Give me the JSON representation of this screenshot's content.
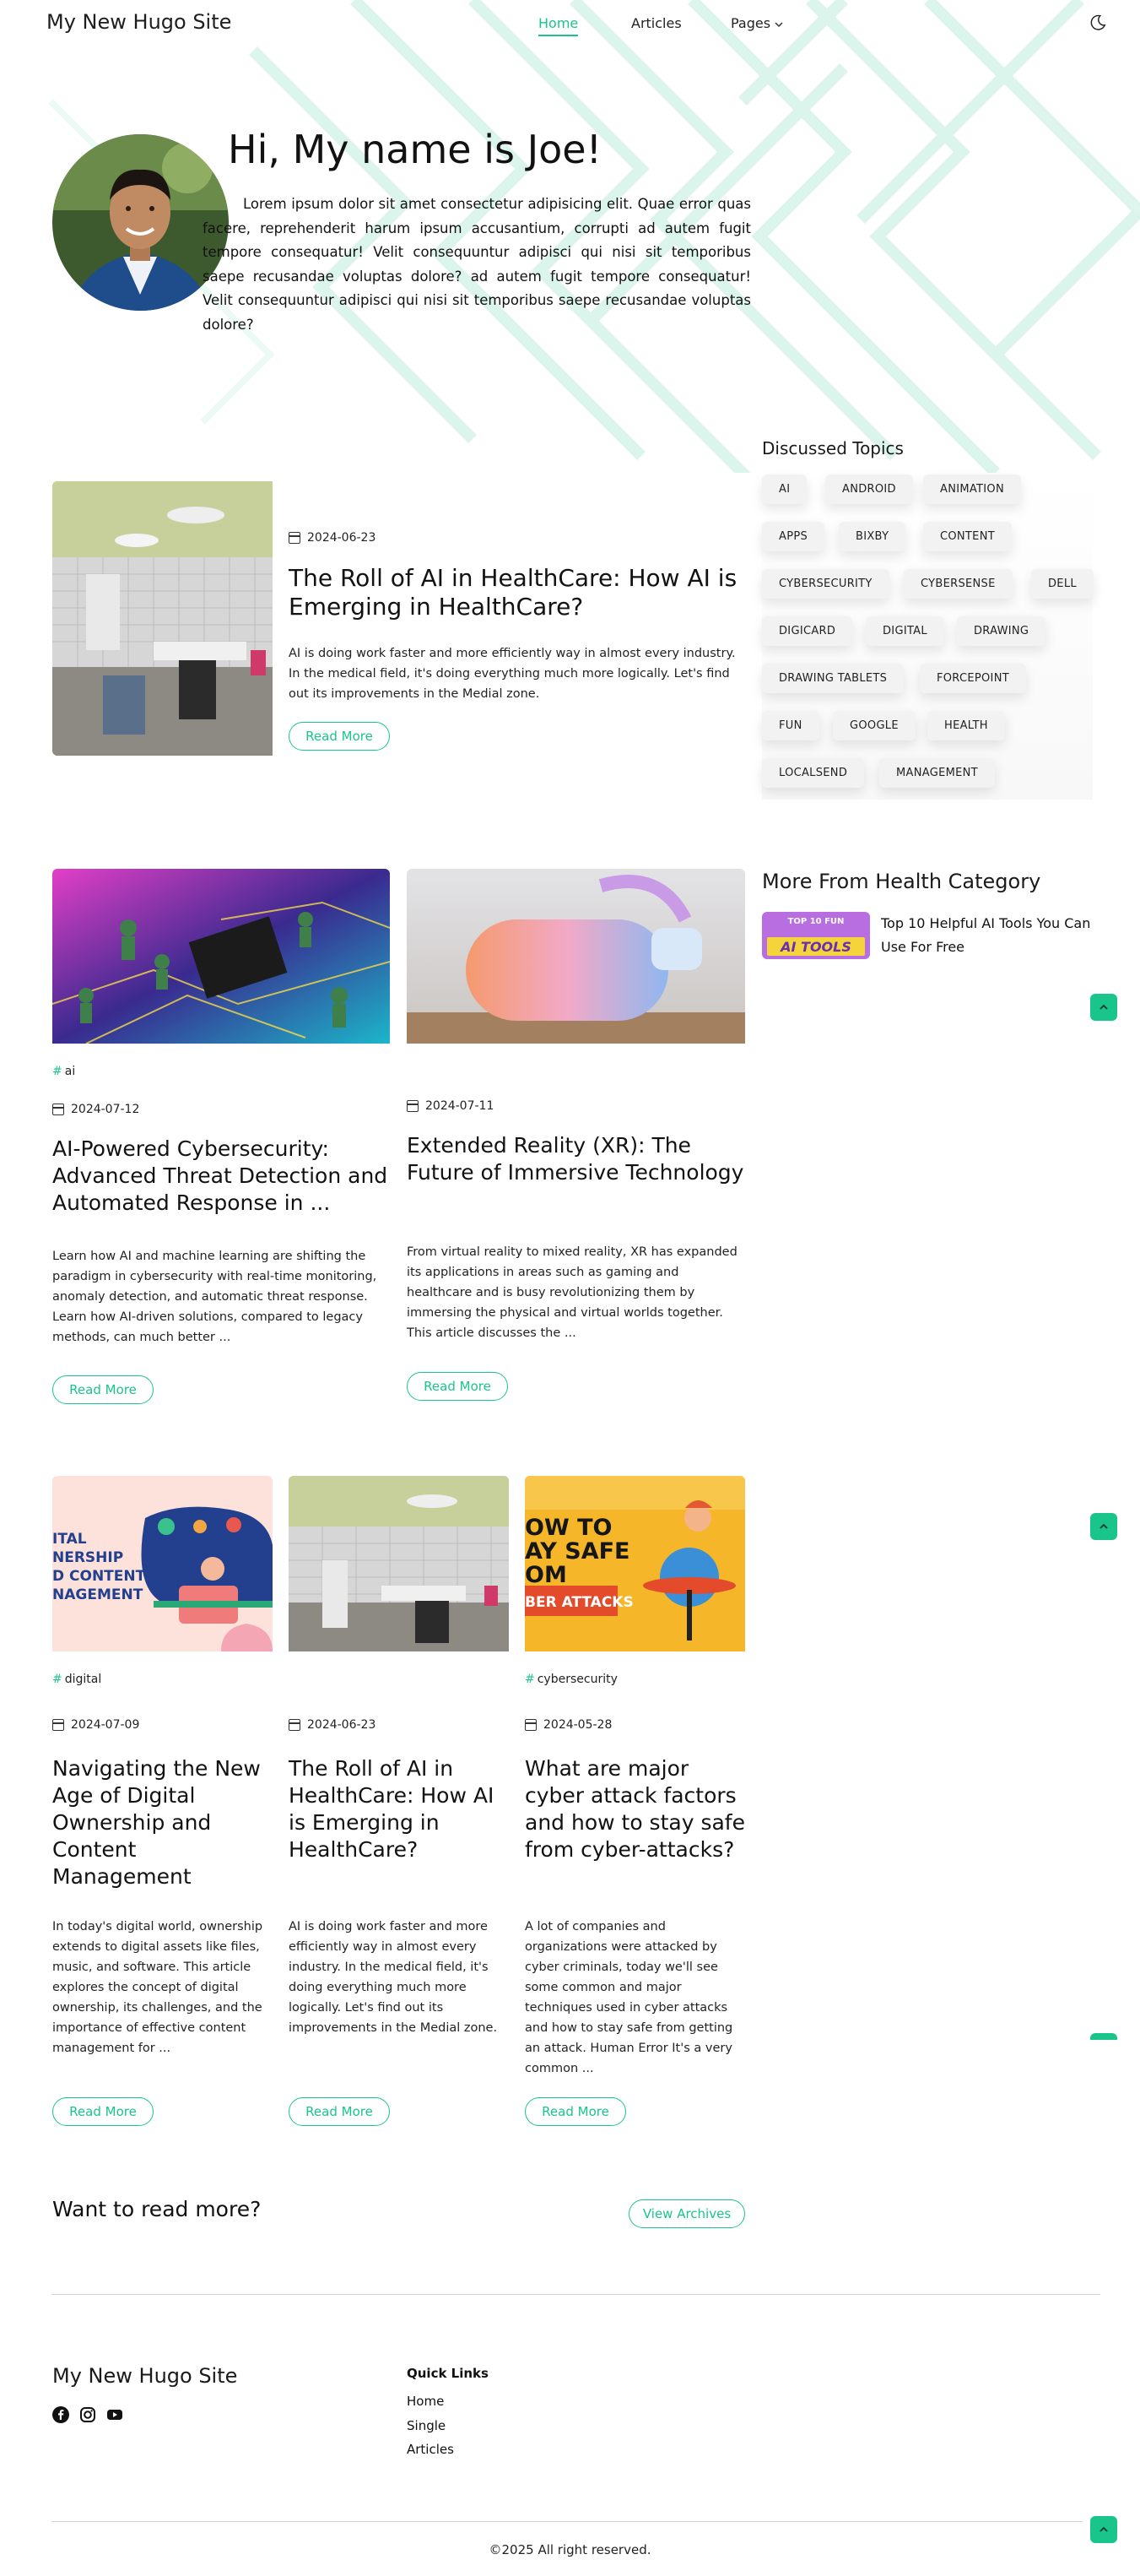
{
  "header": {
    "site_title": "My New Hugo Site",
    "nav": [
      {
        "label": "Home",
        "active": true
      },
      {
        "label": "Articles",
        "active": false
      },
      {
        "label": "Pages",
        "active": false,
        "has_dropdown": true
      }
    ],
    "theme_icon": "moon-icon"
  },
  "hero": {
    "title": "Hi, My name is Joe!",
    "text": "Lorem ipsum dolor sit amet consectetur adipisicing elit. Quae error quas facere, reprehenderit harum ipsum accusantium, corrupti ad autem fugit tempore consequatur! Velit consequuntur adipisci qui nisi sit temporibus saepe recusandae voluptas dolore? ad autem fugit tempore consequatur! Velit consequuntur adipisci qui nisi sit temporibus saepe recusandae voluptas dolore?"
  },
  "featured": {
    "date": "2024-06-23",
    "title": "The Roll of AI in HealthCare: How AI is Emerging in HealthCare?",
    "excerpt": "AI is doing work faster and more efficiently way in almost every industry. In the medical field, it's doing everything much more logically. Let's find out its improvements in the Medial zone.",
    "button": "Read More"
  },
  "sidebar": {
    "topics_heading": "Discussed Topics",
    "tags": [
      "AI",
      "ANDROID",
      "ANIMATION",
      "APPS",
      "BIXBY",
      "CONTENT",
      "CYBERSECURITY",
      "CYBERSENSE",
      "DELL",
      "DIGICARD",
      "DIGITAL",
      "DRAWING",
      "DRAWING TABLETS",
      "FORCEPOINT",
      "FUN",
      "GOOGLE",
      "HEALTH",
      "LOCALSEND",
      "MANAGEMENT"
    ],
    "more_heading": "More From Health Category",
    "more_thumb_text": [
      "TOP 10 FUN",
      "AI TOOLS"
    ],
    "more_title": "Top 10 Helpful AI Tools You Can Use For Free"
  },
  "row2": [
    {
      "category": "ai",
      "date": "2024-07-12",
      "title": "AI-Powered Cybersecurity: Advanced Threat Detection and Automated Response in ...",
      "excerpt": "Learn how AI and machine learning are shifting the paradigm in cybersecurity with real-time monitoring, anomaly detection, and automatic threat response. Learn how AI-driven solutions, compared to legacy methods, can much better ...",
      "button": "Read More"
    },
    {
      "category": "",
      "date": "2024-07-11",
      "title": "Extended Reality (XR): The Future of Immersive Technology",
      "excerpt": "From virtual reality to mixed reality, XR has expanded its applications in areas such as gaming and healthcare and is busy revolutionizing them by immersing the physical and virtual worlds together. This article discusses the ...",
      "button": "Read More"
    }
  ],
  "row3": [
    {
      "category": "digital",
      "date": "2024-07-09",
      "title": "Navigating the New Age of Digital Ownership and Content Management",
      "excerpt": "In today's digital world, ownership extends to digital assets like files, music, and software. This article explores the concept of digital ownership, its challenges, and the importance of effective content management for ...",
      "button": "Read More",
      "img_text": [
        "ITAL",
        "NERSHIP",
        "D CONTENT",
        "NAGEMENT"
      ]
    },
    {
      "category": "",
      "date": "2024-06-23",
      "title": "The Roll of AI in HealthCare: How AI is Emerging in HealthCare?",
      "excerpt": "AI is doing work faster and more efficiently way in almost every industry. In the medical field, it's doing everything much more logically. Let's find out its improvements in the Medial zone.",
      "button": "Read More"
    },
    {
      "category": "cybersecurity",
      "date": "2024-05-28",
      "title": "What are major cyber attack factors and how to stay safe from cyber-attacks?",
      "excerpt": "A lot of companies and organizations were attacked by cyber criminals, today we'll see some common and major techniques used in cyber attacks and how to stay safe from getting an attack. Human Error It's a very common ...",
      "button": "Read More",
      "img_text": [
        "OW TO",
        "AY SAFE",
        "OM",
        "BER ATTACKS"
      ]
    }
  ],
  "more": {
    "heading": "Want to read more?",
    "button": "View Archives"
  },
  "footer": {
    "site_title": "My New Hugo Site",
    "social_icons": [
      "facebook-icon",
      "instagram-icon",
      "youtube-icon"
    ],
    "quick_links_title": "Quick Links",
    "quick_links": [
      "Home",
      "Single",
      "Articles"
    ],
    "copyright": "©2025 All right reserved."
  },
  "colors": {
    "accent": "#19c58a",
    "text": "#1a1a1a",
    "tag_bg": "#f2f2f2"
  }
}
